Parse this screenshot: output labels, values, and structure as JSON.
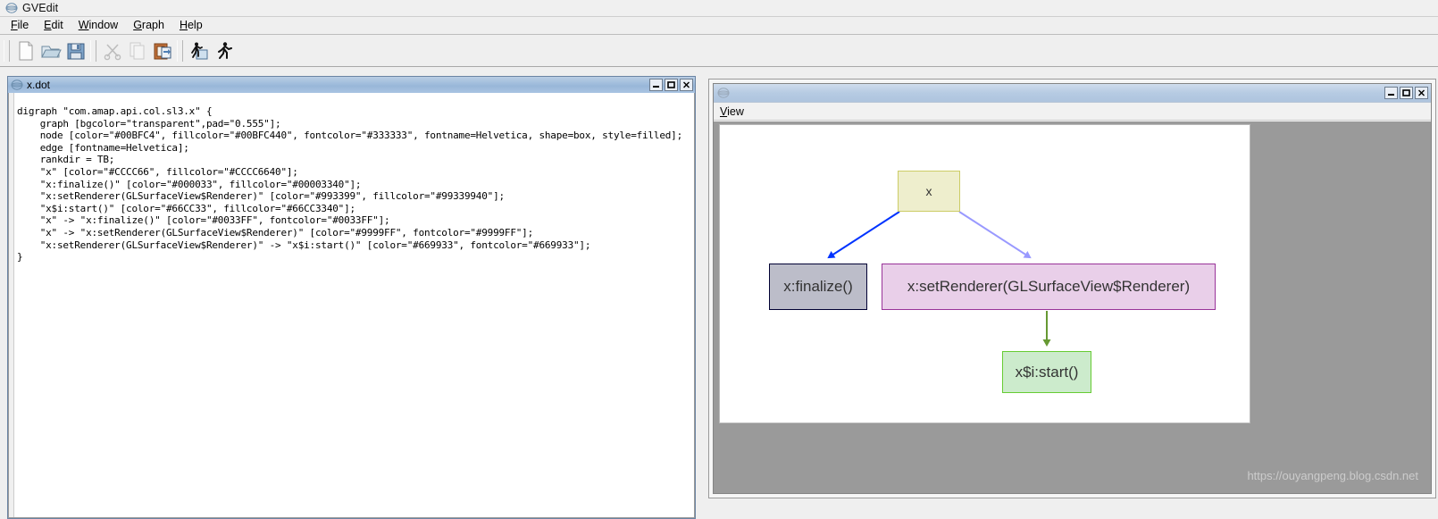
{
  "app": {
    "title": "GVEdit",
    "icon": "graphviz-logo-icon",
    "background_color": "#efefef"
  },
  "menubar": {
    "items": [
      {
        "label": "File",
        "mnemonic": "F"
      },
      {
        "label": "Edit",
        "mnemonic": "E"
      },
      {
        "label": "Window",
        "mnemonic": "W"
      },
      {
        "label": "Graph",
        "mnemonic": "G"
      },
      {
        "label": "Help",
        "mnemonic": "H"
      }
    ]
  },
  "toolbar": {
    "groups": [
      {
        "buttons": [
          {
            "name": "new-file-button",
            "icon": "new-document-icon",
            "enabled": true
          },
          {
            "name": "open-file-button",
            "icon": "open-folder-icon",
            "enabled": true
          },
          {
            "name": "save-file-button",
            "icon": "floppy-save-icon",
            "enabled": true
          }
        ]
      },
      {
        "buttons": [
          {
            "name": "cut-button",
            "icon": "scissors-icon",
            "enabled": false
          },
          {
            "name": "copy-button",
            "icon": "copy-pages-icon",
            "enabled": false
          },
          {
            "name": "paste-button",
            "icon": "clipboard-paste-icon",
            "enabled": true
          }
        ]
      },
      {
        "buttons": [
          {
            "name": "run-layout-button",
            "icon": "runner-window-icon",
            "enabled": true
          },
          {
            "name": "run-button",
            "icon": "runner-icon",
            "enabled": true
          }
        ]
      }
    ]
  },
  "editor_window": {
    "title": "x.dot",
    "icon": "graphviz-logo-icon",
    "buttons": [
      {
        "name": "minimize-button",
        "glyph": "minimize"
      },
      {
        "name": "maximize-button",
        "glyph": "maximize"
      },
      {
        "name": "close-button",
        "glyph": "close"
      }
    ],
    "source": "digraph \"com.amap.api.col.sl3.x\" {\n    graph [bgcolor=\"transparent\",pad=\"0.555\"];\n    node [color=\"#00BFC4\", fillcolor=\"#00BFC440\", fontcolor=\"#333333\", fontname=Helvetica, shape=box, style=filled];\n    edge [fontname=Helvetica];\n    rankdir = TB;\n    \"x\" [color=\"#CCCC66\", fillcolor=\"#CCCC6640\"];\n    \"x:finalize()\" [color=\"#000033\", fillcolor=\"#00003340\"];\n    \"x:setRenderer(GLSurfaceView$Renderer)\" [color=\"#993399\", fillcolor=\"#99339940\"];\n    \"x$i:start()\" [color=\"#66CC33\", fillcolor=\"#66CC3340\"];\n    \"x\" -> \"x:finalize()\" [color=\"#0033FF\", fontcolor=\"#0033FF\"];\n    \"x\" -> \"x:setRenderer(GLSurfaceView$Renderer)\" [color=\"#9999FF\", fontcolor=\"#9999FF\"];\n    \"x:setRenderer(GLSurfaceView$Renderer)\" -> \"x$i:start()\" [color=\"#669933\", fontcolor=\"#669933\"];\n}"
  },
  "viewer_window": {
    "title": "",
    "icon": "graphviz-logo-icon",
    "menu": {
      "label": "View",
      "mnemonic": "V"
    },
    "buttons": [
      {
        "name": "minimize-button",
        "glyph": "minimize"
      },
      {
        "name": "maximize-button",
        "glyph": "maximize"
      },
      {
        "name": "close-button",
        "glyph": "close"
      }
    ],
    "canvas_background": "#ffffff",
    "surround_background": "#9a9a9a"
  },
  "graph": {
    "name": "com.amap.api.col.sl3.x",
    "rankdir": "TB",
    "nodes": [
      {
        "id": "x",
        "label": "x",
        "border_color": "#cccc66",
        "fill_color": "#eeeecd",
        "font_color": "#333333"
      },
      {
        "id": "finalize",
        "label": "x:finalize()",
        "border_color": "#000033",
        "fill_color": "#bcbdc9",
        "font_color": "#333333"
      },
      {
        "id": "render",
        "label": "x:setRenderer(GLSurfaceView$Renderer)",
        "border_color": "#993399",
        "fill_color": "#e9cfe9",
        "font_color": "#333333"
      },
      {
        "id": "start",
        "label": "x$i:start()",
        "border_color": "#66cc33",
        "fill_color": "#ccebcc",
        "font_color": "#333333"
      }
    ],
    "edges": [
      {
        "from": "x",
        "to": "finalize",
        "color": "#0033ff"
      },
      {
        "from": "x",
        "to": "render",
        "color": "#9999ff"
      },
      {
        "from": "render",
        "to": "start",
        "color": "#669933"
      }
    ]
  },
  "watermark": {
    "text": "https://ouyangpeng.blog.csdn.net"
  }
}
